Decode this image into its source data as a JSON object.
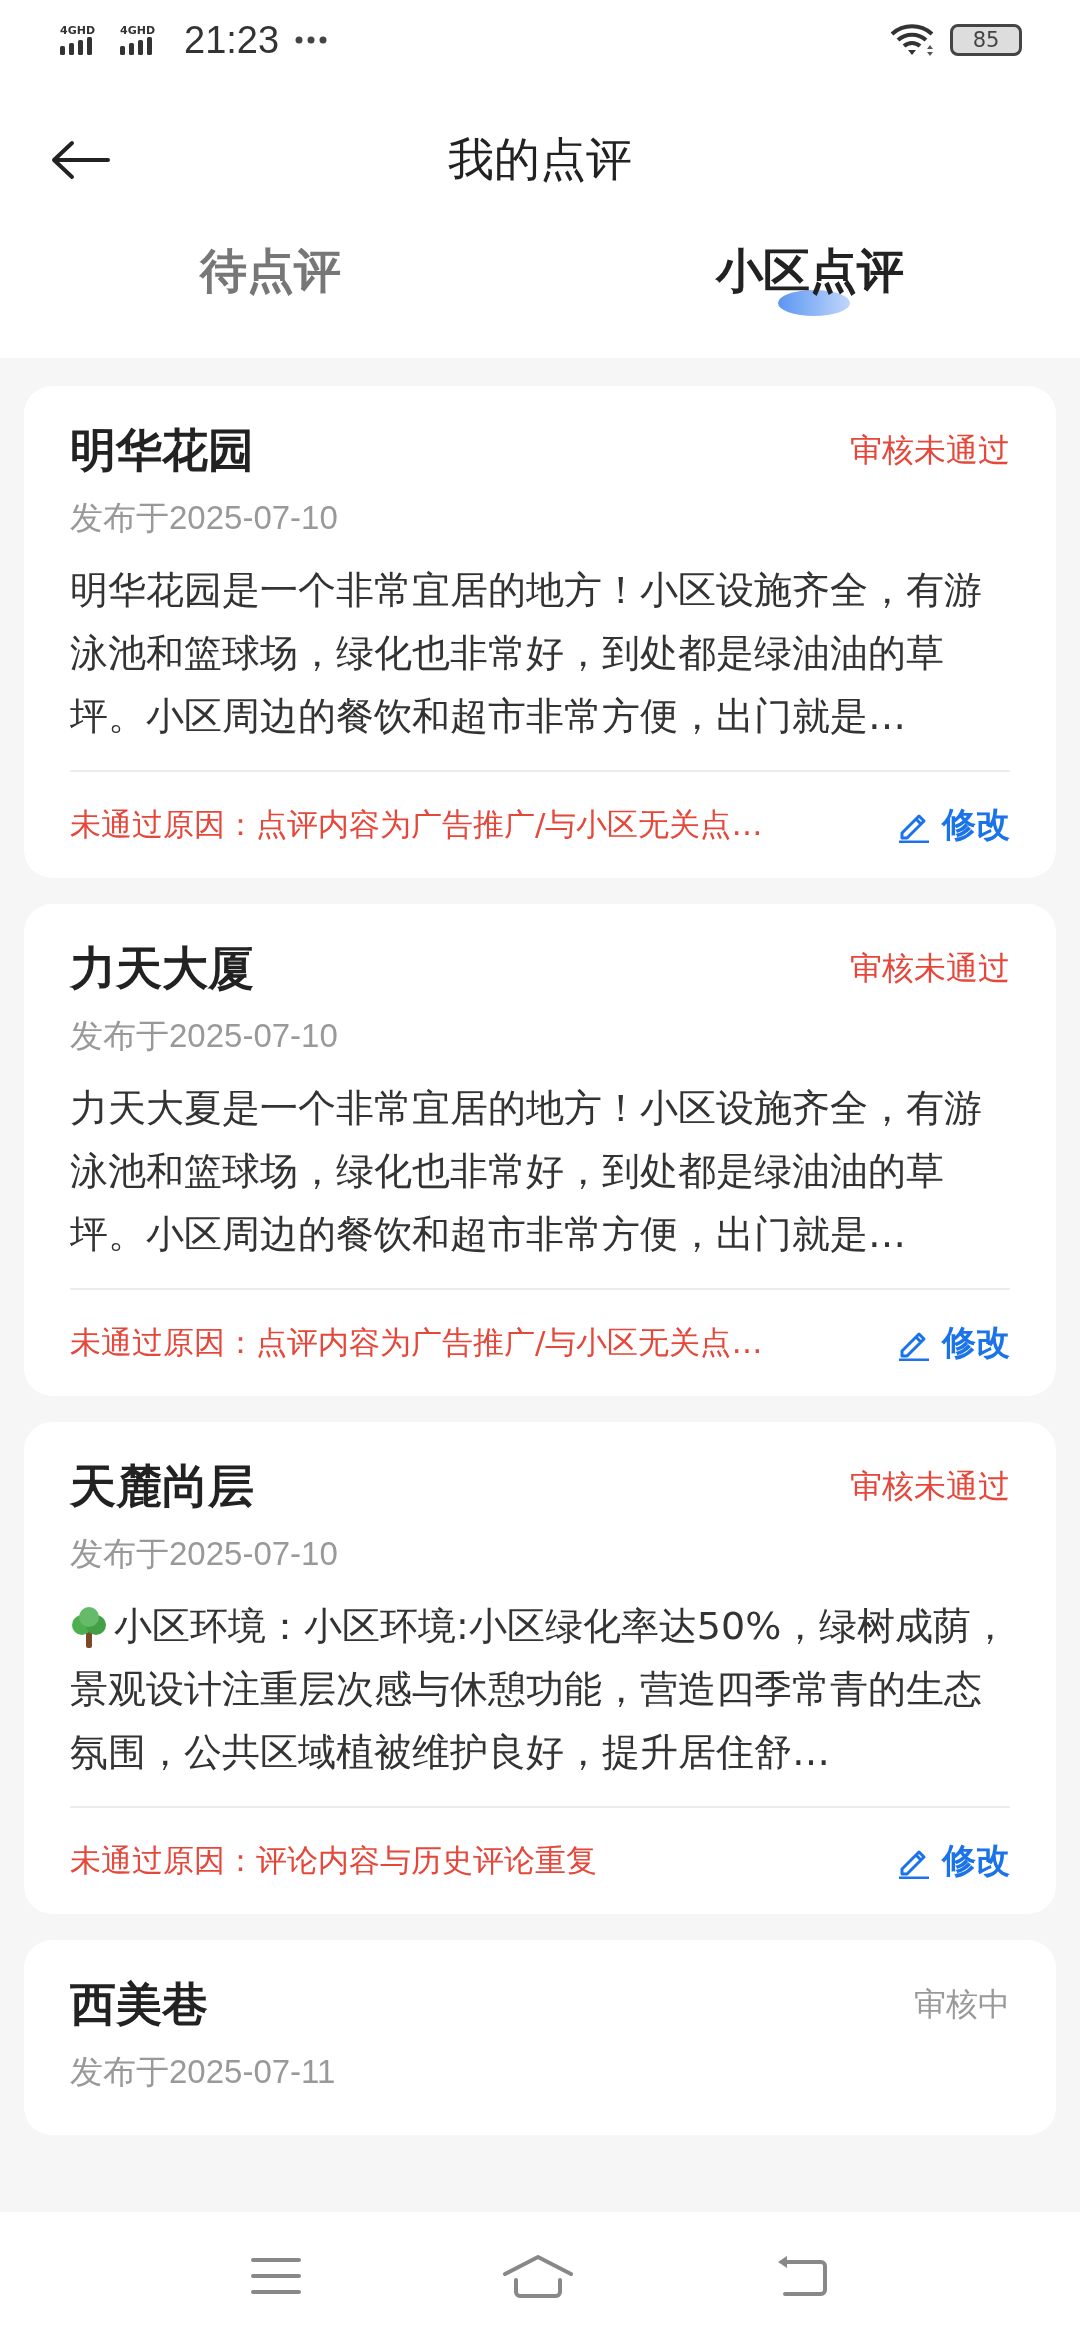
{
  "status_bar": {
    "networks": [
      "4GHD",
      "4GHD"
    ],
    "time": "21:23",
    "battery": "85"
  },
  "header": {
    "title": "我的点评"
  },
  "tabs": [
    {
      "label": "待点评",
      "selected": false
    },
    {
      "label": "小区点评",
      "selected": true
    }
  ],
  "reviews": [
    {
      "name": "明华花园",
      "status": "审核未通过",
      "rejected": true,
      "date": "发布于2025-07-10",
      "kind": "plain",
      "body": "明华花园是一个非常宜居的地方！小区设施齐全，有游泳池和篮球场，绿化也非常好，到处都是绿油油的草坪。小区周边的餐饮和超市非常方便，出门就是…",
      "reason": "未通过原因：点评内容为广告推广/与小区无关点…",
      "action": "修改"
    },
    {
      "name": "力天大厦",
      "status": "审核未通过",
      "rejected": true,
      "date": "发布于2025-07-10",
      "kind": "plain",
      "body": "力天大夏是一个非常宜居的地方！小区设施齐全，有游泳池和篮球场，绿化也非常好，到处都是绿油油的草坪。小区周边的餐饮和超市非常方便，出门就是…",
      "reason": "未通过原因：点评内容为广告推广/与小区无关点…",
      "action": "修改"
    },
    {
      "name": "天麓尚层",
      "status": "审核未通过",
      "rejected": true,
      "date": "发布于2025-07-10",
      "kind": "tree-lead",
      "body": "小区环境：小区环境:小区绿化率达50%，绿树成荫，景观设计注重层次感与休憩功能，营造四季常青的生态氛围，公共区域植被维护良好，提升居住舒…",
      "reason": "未通过原因：评论内容与历史评论重复",
      "action": "修改"
    },
    {
      "name": "西美巷",
      "status": "审核中",
      "rejected": false,
      "date": "发布于2025-07-11"
    }
  ]
}
